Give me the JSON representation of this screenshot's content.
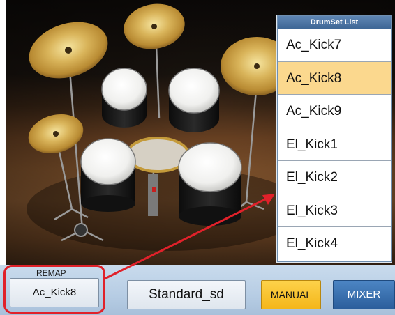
{
  "drumset_list": {
    "title": "DrumSet List",
    "items": [
      "Ac_Kick7",
      "Ac_Kick8",
      "Ac_Kick9",
      "El_Kick1",
      "El_Kick2",
      "El_Kick3",
      "El_Kick4"
    ],
    "selected_index": 1
  },
  "bottom_bar": {
    "remap_label": "REMAP",
    "remap_value": "Ac_Kick8",
    "drumset_value": "Standard_sd",
    "manual_label": "MANUAL",
    "mixer_label": "MIXER"
  },
  "colors": {
    "selected_item": "#fbd88e",
    "manual_button": "#f4b61a",
    "mixer_button": "#2b5e9c",
    "annotation": "#e0212a"
  },
  "icons": [
    "drum-kit-image",
    "annotation-arrow"
  ]
}
